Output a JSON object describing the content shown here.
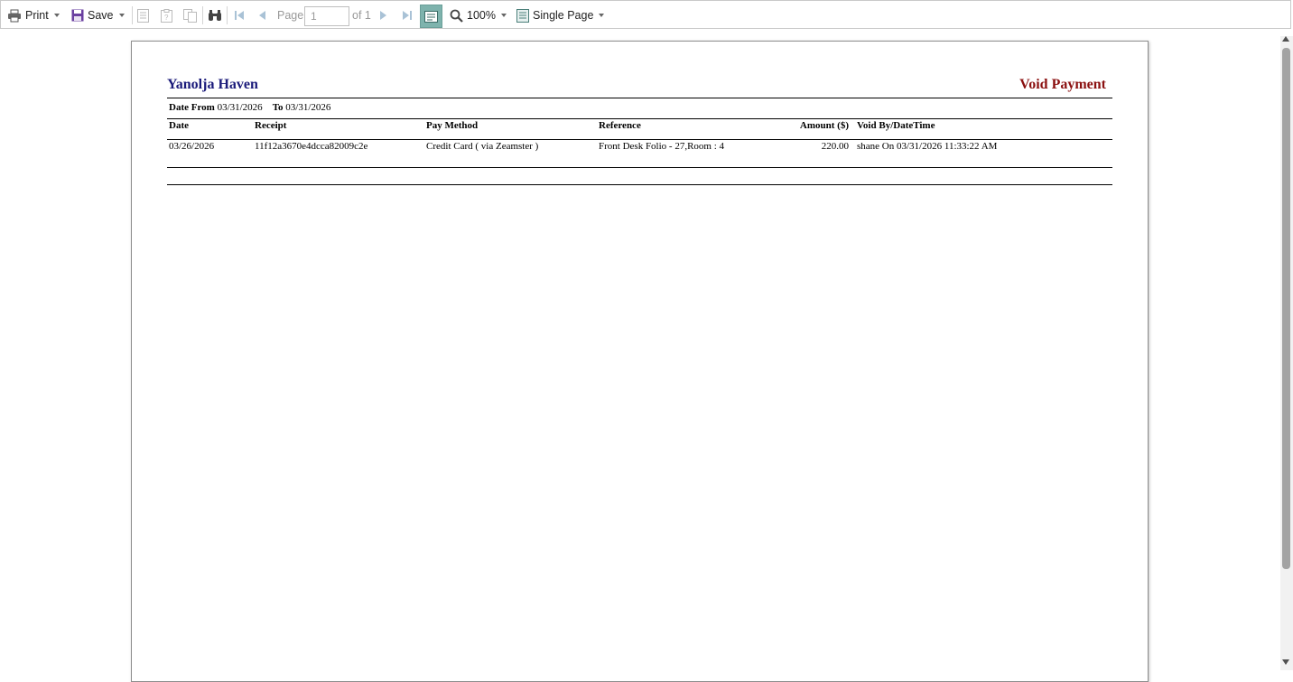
{
  "toolbar": {
    "print_label": "Print",
    "save_label": "Save",
    "page_label": "Page",
    "page_value": "1",
    "page_of": "of 1",
    "zoom_label": "100%",
    "view_label": "Single Page"
  },
  "report": {
    "title_left": "Yanolja Haven",
    "title_right": "Void Payment",
    "date_from_label": "Date From",
    "date_from": "03/31/2026",
    "to_label": "To",
    "date_to": "03/31/2026",
    "columns": [
      "Date",
      "Receipt",
      "Pay Method",
      "Reference",
      "Amount ($)",
      "Void By/DateTime"
    ],
    "rows": [
      [
        "03/26/2026",
        "11f12a3670e4dcca82009c2e",
        "Credit Card ( via Zeamster )",
        "Front Desk Folio - 27,Room : 4",
        "220.00",
        "shane On 03/31/2026 11:33:22 AM"
      ]
    ]
  },
  "colors": {
    "title_left": "#1a1a7a",
    "title_right": "#8b1010",
    "active_button": "#7eb3ad"
  }
}
